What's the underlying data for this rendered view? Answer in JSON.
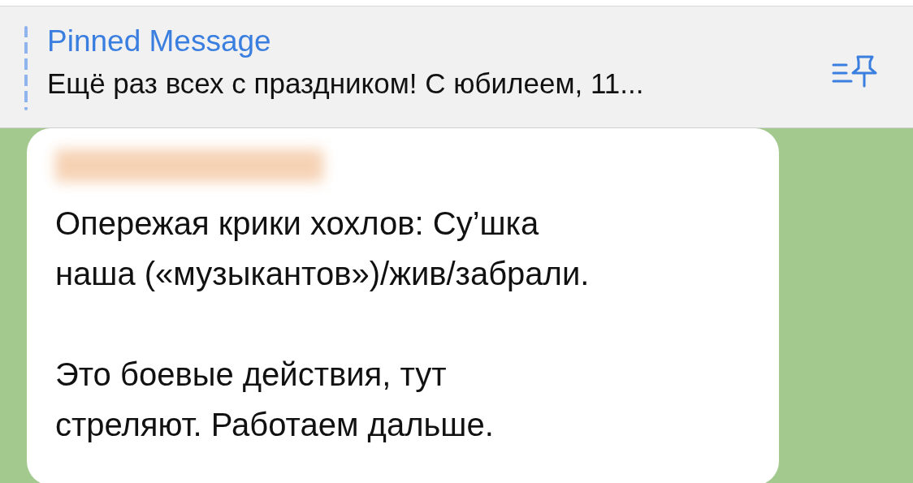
{
  "pinned": {
    "title": "Pinned Message",
    "text": "Ещё раз всех с праздником! С юбилеем, 11..."
  },
  "message": {
    "paragraphs": [
      "Опережая крики хохлов: Су’шка\nнаша («музыкантов»)/жив/забрали.",
      "Это боевые действия, тут\nстреляют. Работаем дальше."
    ]
  }
}
